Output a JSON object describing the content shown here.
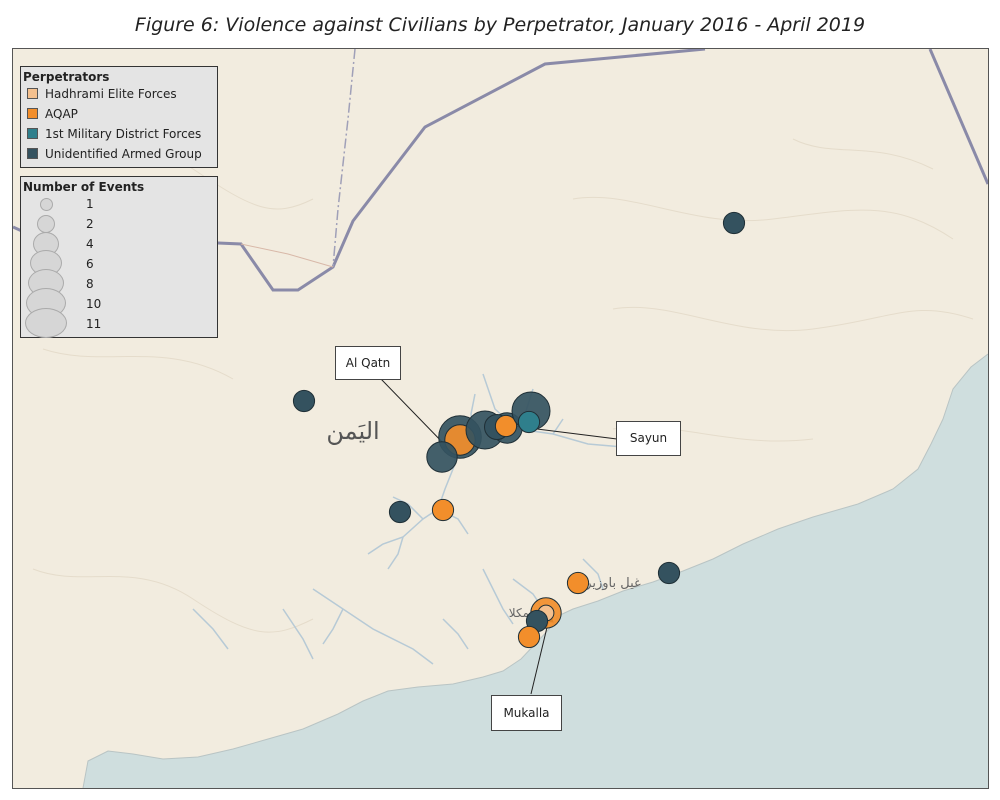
{
  "title": "Figure 6: Violence against Civilians by Perpetrator, January 2016 - April 2019",
  "place_labels": {
    "yemen": "اليَمن",
    "ghayl_bawazir": "غيل باوزير",
    "mukalla_ar": "لمكلا"
  },
  "legend_perpetrators": {
    "title": "Perpetrators",
    "items": [
      {
        "label": "Hadhrami Elite Forces",
        "color": "#f4c08e"
      },
      {
        "label": "AQAP",
        "color": "#f28e2b"
      },
      {
        "label": "1st Military District Forces",
        "color": "#2f7f8c"
      },
      {
        "label": "Unidentified Armed Group",
        "color": "#34525f"
      }
    ]
  },
  "legend_events": {
    "title": "Number of Events",
    "items": [
      {
        "label": "1",
        "value": 1
      },
      {
        "label": "2",
        "value": 2
      },
      {
        "label": "4",
        "value": 4
      },
      {
        "label": "6",
        "value": 6
      },
      {
        "label": "8",
        "value": 8
      },
      {
        "label": "10",
        "value": 10
      },
      {
        "label": "11",
        "value": 11
      }
    ]
  },
  "callouts": {
    "al_qatn": "Al Qatn",
    "sayun": "Sayun",
    "mukalla": "Mukalla"
  },
  "colors": {
    "land": "#f2ecdf",
    "sea": "#cfdede",
    "border": "#8a8aa8",
    "river": "#b7cad6"
  },
  "events": [
    {
      "perpetrator": "Unidentified Armed Group",
      "count": 1,
      "place": "northeast desert"
    },
    {
      "perpetrator": "Unidentified Armed Group",
      "count": 1,
      "place": "west of Al Qatn"
    },
    {
      "perpetrator": "Unidentified Armed Group",
      "count": 11,
      "place": "Al Qatn"
    },
    {
      "perpetrator": "AQAP",
      "count": 4,
      "place": "Al Qatn"
    },
    {
      "perpetrator": "Unidentified Armed Group",
      "count": 4,
      "place": "south of Al Qatn"
    },
    {
      "perpetrator": "Unidentified Armed Group",
      "count": 8,
      "place": "Shibam"
    },
    {
      "perpetrator": "Unidentified Armed Group",
      "count": 4,
      "place": "Sayun"
    },
    {
      "perpetrator": "Unidentified Armed Group",
      "count": 2,
      "place": "Sayun"
    },
    {
      "perpetrator": "AQAP",
      "count": 1,
      "place": "Sayun"
    },
    {
      "perpetrator": "Unidentified Armed Group",
      "count": 8,
      "place": "east of Sayun"
    },
    {
      "perpetrator": "1st Military District Forces",
      "count": 1,
      "place": "east of Sayun"
    },
    {
      "perpetrator": "Unidentified Armed Group",
      "count": 1,
      "place": "southwest wadi"
    },
    {
      "perpetrator": "AQAP",
      "count": 1,
      "place": "south of Al Qatn"
    },
    {
      "perpetrator": "AQAP",
      "count": 1,
      "place": "Ghayl Bawazir"
    },
    {
      "perpetrator": "Unidentified Armed Group",
      "count": 1,
      "place": "east coast"
    },
    {
      "perpetrator": "AQAP",
      "count": 4,
      "place": "Mukalla"
    },
    {
      "perpetrator": "Hadhrami Elite Forces",
      "count": 1,
      "place": "Mukalla"
    },
    {
      "perpetrator": "Unidentified Armed Group",
      "count": 1,
      "place": "Mukalla"
    },
    {
      "perpetrator": "AQAP",
      "count": 1,
      "place": "west of Mukalla"
    }
  ]
}
